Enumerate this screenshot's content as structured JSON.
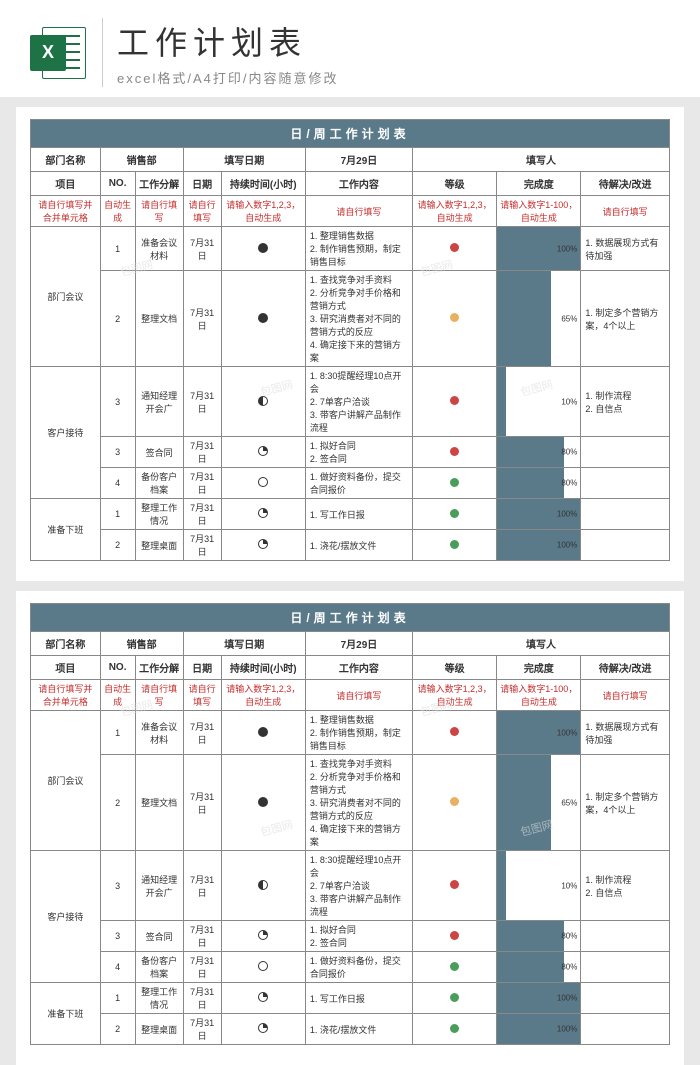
{
  "header": {
    "main_title": "工作计划表",
    "sub_title": "excel格式/A4打印/内容随意修改",
    "icon_letter": "X"
  },
  "table_title": "日/周工作计划表",
  "info_row": {
    "dept_label": "部门名称",
    "dept_value": "销售部",
    "date_label": "填写日期",
    "date_value": "7月29日",
    "filler_label": "填写人"
  },
  "col_headers": [
    "项目",
    "NO.",
    "工作分解",
    "日期",
    "持续时间(小时)",
    "工作内容",
    "等级",
    "完成度",
    "待解决/改进"
  ],
  "hint_row": [
    "请自行填写并合并单元格",
    "自动生成",
    "请自行填写",
    "请自行填写",
    "请输入数字1,2,3，自动生成",
    "请自行填写",
    "请输入数字1,2,3，自动生成",
    "请输入数字1-100，自动生成",
    "请自行填写"
  ],
  "groups": [
    {
      "name": "部门会议",
      "rows": [
        {
          "no": "1",
          "task": "准备会议材料",
          "date": "7月31日",
          "dur": "full",
          "content": "1. 整理销售数据\n2. 制作销售预期，制定销售目标",
          "lvl": "red",
          "pct": 100,
          "note": "1. 数据展现方式有待加强"
        },
        {
          "no": "2",
          "task": "整理文档",
          "date": "7月31日",
          "dur": "full",
          "content": "1. 查找竞争对手资料\n2. 分析竞争对手价格和营销方式\n3. 研究消费者对不同的营销方式的反应\n4. 确定接下来的营销方案",
          "lvl": "orange",
          "pct": 65,
          "note": "1. 制定多个营销方案，4个以上"
        }
      ]
    },
    {
      "name": "客户接待",
      "rows": [
        {
          "no": "3",
          "task": "通知经理开会广",
          "date": "7月31日",
          "dur": "half",
          "content": "1. 8:30提醒经理10点开会\n2. 7单客户洽谈\n3. 带客户讲解产品制作流程",
          "lvl": "red",
          "pct": 10,
          "note": "1. 制作流程\n2. 自信点"
        },
        {
          "no": "3",
          "task": "签合同",
          "date": "7月31日",
          "dur": "qtr",
          "content": "1. 拟好合同\n2. 签合同",
          "lvl": "red",
          "pct": 80,
          "note": ""
        },
        {
          "no": "4",
          "task": "备份客户档案",
          "date": "7月31日",
          "dur": "empty",
          "content": "1. 做好资料备份，提交合同报价",
          "lvl": "green",
          "pct": 80,
          "note": ""
        }
      ]
    },
    {
      "name": "准备下班",
      "rows": [
        {
          "no": "1",
          "task": "整理工作情况",
          "date": "7月31日",
          "dur": "qtr",
          "content": "1. 写工作日报",
          "lvl": "green",
          "pct": 100,
          "note": ""
        },
        {
          "no": "2",
          "task": "整理桌面",
          "date": "7月31日",
          "dur": "qtr",
          "content": "1. 浇花/摆放文件",
          "lvl": "green",
          "pct": 100,
          "note": ""
        }
      ]
    }
  ],
  "watermark": "包图网"
}
